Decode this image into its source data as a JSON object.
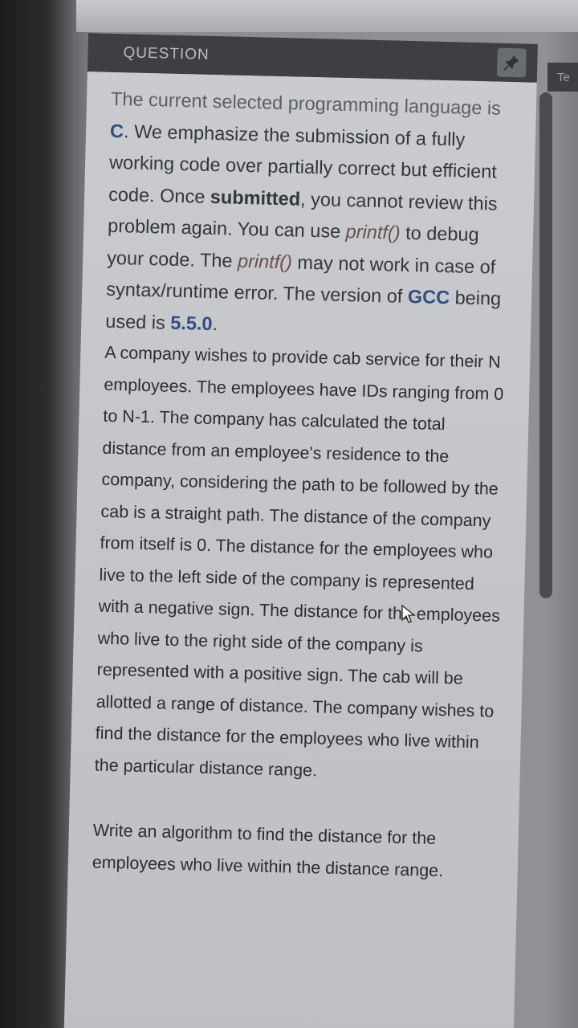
{
  "panel": {
    "title": "QUESTION",
    "pin_icon": "pin-icon"
  },
  "right_tab": {
    "label": "Te"
  },
  "intro": {
    "s1": "The current selected programming language is ",
    "lang": "C",
    "s2": ". We emphasize the submission of a fully working code over partially correct but efficient code. Once ",
    "submitted": "submitted",
    "s3": ", you cannot review this problem again. You can use ",
    "printf1": "printf()",
    "s4": " to debug your code. The ",
    "printf2": "printf()",
    "s5": " may not work in case of syntax/runtime error. The version of ",
    "gcc": "GCC",
    "s6": " being used is ",
    "version": "5.5.0",
    "s7": "."
  },
  "problem": {
    "text": "A company wishes to provide cab service for their N employees. The employees have IDs ranging from 0 to N-1. The company has calculated the total distance from an employee's residence to the company, considering the path to be followed by the cab is a straight path. The distance of the company from itself is 0. The distance for the employees who live to the left side of the company is represented with a negative sign. The distance for the employees who live to the right side of the company is represented with a positive sign. The cab will be allotted a range of distance. The company wishes to find the distance for the employees who live within the particular distance range."
  },
  "task": {
    "text": "Write an algorithm to find the distance for the employees who live within the distance range."
  },
  "colors": {
    "header_bg": "#3d3f43",
    "body_bg": "#c6c8cc",
    "accent_blue": "#2d4f84",
    "text": "#2b2d30"
  }
}
